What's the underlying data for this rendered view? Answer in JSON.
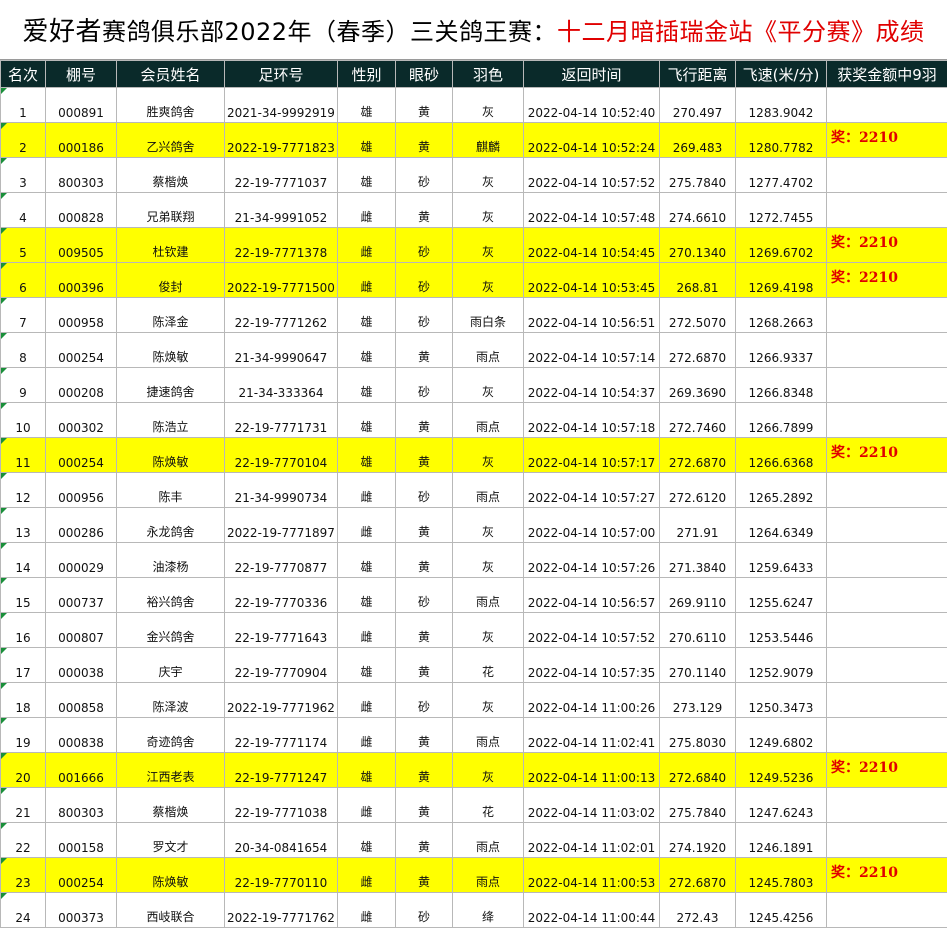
{
  "title": {
    "part1": "爱好者",
    "part2": "赛鸽俱乐部2022年（春季）三关鸽王赛：",
    "part3": "十二月暗插瑞金站《平分赛》成绩"
  },
  "headers": [
    "名次",
    "棚号",
    "会员姓名",
    "足环号",
    "性别",
    "眼砂",
    "羽色",
    "返回时间",
    "飞行距离",
    "飞速(米/分)",
    "获奖金额中9羽"
  ],
  "colors": {
    "highlight": "#ffff00",
    "prize": "#e00000",
    "header_bg": "#0a2a2a"
  },
  "rows": [
    {
      "rank": "1",
      "shed": "000891",
      "name": "胜爽鸽舍",
      "ring": "2021-34-9992919",
      "sex": "雄",
      "eye": "黄",
      "color": "灰",
      "time": "2022-04-14 10:52:40",
      "dist": "270.497",
      "speed": "1283.9042",
      "prize": "",
      "hl": false
    },
    {
      "rank": "2",
      "shed": "000186",
      "name": "乙兴鸽舍",
      "ring": "2022-19-7771823",
      "sex": "雄",
      "eye": "黄",
      "color": "麒麟",
      "time": "2022-04-14 10:52:24",
      "dist": "269.483",
      "speed": "1280.7782",
      "prize": "奖：2210",
      "hl": true
    },
    {
      "rank": "3",
      "shed": "800303",
      "name": "蔡楷焕",
      "ring": "22-19-7771037",
      "sex": "雄",
      "eye": "砂",
      "color": "灰",
      "time": "2022-04-14 10:57:52",
      "dist": "275.7840",
      "speed": "1277.4702",
      "prize": "",
      "hl": false
    },
    {
      "rank": "4",
      "shed": "000828",
      "name": "兄弟联翔",
      "ring": "21-34-9991052",
      "sex": "雌",
      "eye": "黄",
      "color": "灰",
      "time": "2022-04-14 10:57:48",
      "dist": "274.6610",
      "speed": "1272.7455",
      "prize": "",
      "hl": false
    },
    {
      "rank": "5",
      "shed": "009505",
      "name": "杜钦建",
      "ring": "22-19-7771378",
      "sex": "雌",
      "eye": "砂",
      "color": "灰",
      "time": "2022-04-14 10:54:45",
      "dist": "270.1340",
      "speed": "1269.6702",
      "prize": "奖：2210",
      "hl": true
    },
    {
      "rank": "6",
      "shed": "000396",
      "name": "俊封",
      "ring": "2022-19-7771500",
      "sex": "雌",
      "eye": "砂",
      "color": "灰",
      "time": "2022-04-14 10:53:45",
      "dist": "268.81",
      "speed": "1269.4198",
      "prize": "奖：2210",
      "hl": true
    },
    {
      "rank": "7",
      "shed": "000958",
      "name": "陈泽金",
      "ring": "22-19-7771262",
      "sex": "雄",
      "eye": "砂",
      "color": "雨白条",
      "time": "2022-04-14 10:56:51",
      "dist": "272.5070",
      "speed": "1268.2663",
      "prize": "",
      "hl": false
    },
    {
      "rank": "8",
      "shed": "000254",
      "name": "陈焕敏",
      "ring": "21-34-9990647",
      "sex": "雄",
      "eye": "黄",
      "color": "雨点",
      "time": "2022-04-14 10:57:14",
      "dist": "272.6870",
      "speed": "1266.9337",
      "prize": "",
      "hl": false
    },
    {
      "rank": "9",
      "shed": "000208",
      "name": "捷速鸽舍",
      "ring": "21-34-333364",
      "sex": "雄",
      "eye": "砂",
      "color": "灰",
      "time": "2022-04-14 10:54:37",
      "dist": "269.3690",
      "speed": "1266.8348",
      "prize": "",
      "hl": false
    },
    {
      "rank": "10",
      "shed": "000302",
      "name": "陈浩立",
      "ring": "22-19-7771731",
      "sex": "雄",
      "eye": "黄",
      "color": "雨点",
      "time": "2022-04-14 10:57:18",
      "dist": "272.7460",
      "speed": "1266.7899",
      "prize": "",
      "hl": false
    },
    {
      "rank": "11",
      "shed": "000254",
      "name": "陈焕敏",
      "ring": "22-19-7770104",
      "sex": "雄",
      "eye": "黄",
      "color": "灰",
      "time": "2022-04-14 10:57:17",
      "dist": "272.6870",
      "speed": "1266.6368",
      "prize": "奖：2210",
      "hl": true
    },
    {
      "rank": "12",
      "shed": "000956",
      "name": "陈丰",
      "ring": "21-34-9990734",
      "sex": "雌",
      "eye": "砂",
      "color": "雨点",
      "time": "2022-04-14 10:57:27",
      "dist": "272.6120",
      "speed": "1265.2892",
      "prize": "",
      "hl": false
    },
    {
      "rank": "13",
      "shed": "000286",
      "name": "永龙鸽舍",
      "ring": "2022-19-7771897",
      "sex": "雌",
      "eye": "黄",
      "color": "灰",
      "time": "2022-04-14 10:57:00",
      "dist": "271.91",
      "speed": "1264.6349",
      "prize": "",
      "hl": false
    },
    {
      "rank": "14",
      "shed": "000029",
      "name": "油漆杨",
      "ring": "22-19-7770877",
      "sex": "雄",
      "eye": "黄",
      "color": "灰",
      "time": "2022-04-14 10:57:26",
      "dist": "271.3840",
      "speed": "1259.6433",
      "prize": "",
      "hl": false
    },
    {
      "rank": "15",
      "shed": "000737",
      "name": "裕兴鸽舍",
      "ring": "22-19-7770336",
      "sex": "雄",
      "eye": "砂",
      "color": "雨点",
      "time": "2022-04-14 10:56:57",
      "dist": "269.9110",
      "speed": "1255.6247",
      "prize": "",
      "hl": false
    },
    {
      "rank": "16",
      "shed": "000807",
      "name": "金兴鸽舍",
      "ring": "22-19-7771643",
      "sex": "雌",
      "eye": "黄",
      "color": "灰",
      "time": "2022-04-14 10:57:52",
      "dist": "270.6110",
      "speed": "1253.5446",
      "prize": "",
      "hl": false
    },
    {
      "rank": "17",
      "shed": "000038",
      "name": "庆宇",
      "ring": "22-19-7770904",
      "sex": "雄",
      "eye": "黄",
      "color": "花",
      "time": "2022-04-14 10:57:35",
      "dist": "270.1140",
      "speed": "1252.9079",
      "prize": "",
      "hl": false
    },
    {
      "rank": "18",
      "shed": "000858",
      "name": "陈泽波",
      "ring": "2022-19-7771962",
      "sex": "雌",
      "eye": "砂",
      "color": "灰",
      "time": "2022-04-14 11:00:26",
      "dist": "273.129",
      "speed": "1250.3473",
      "prize": "",
      "hl": false
    },
    {
      "rank": "19",
      "shed": "000838",
      "name": "奇迹鸽舍",
      "ring": "22-19-7771174",
      "sex": "雌",
      "eye": "黄",
      "color": "雨点",
      "time": "2022-04-14 11:02:41",
      "dist": "275.8030",
      "speed": "1249.6802",
      "prize": "",
      "hl": false
    },
    {
      "rank": "20",
      "shed": "001666",
      "name": "江西老表",
      "ring": "22-19-7771247",
      "sex": "雄",
      "eye": "黄",
      "color": "灰",
      "time": "2022-04-14 11:00:13",
      "dist": "272.6840",
      "speed": "1249.5236",
      "prize": "奖：2210",
      "hl": true
    },
    {
      "rank": "21",
      "shed": "800303",
      "name": "蔡楷焕",
      "ring": "22-19-7771038",
      "sex": "雌",
      "eye": "黄",
      "color": "花",
      "time": "2022-04-14 11:03:02",
      "dist": "275.7840",
      "speed": "1247.6243",
      "prize": "",
      "hl": false
    },
    {
      "rank": "22",
      "shed": "000158",
      "name": "罗文才",
      "ring": "20-34-0841654",
      "sex": "雄",
      "eye": "黄",
      "color": "雨点",
      "time": "2022-04-14 11:02:01",
      "dist": "274.1920",
      "speed": "1246.1891",
      "prize": "",
      "hl": false
    },
    {
      "rank": "23",
      "shed": "000254",
      "name": "陈焕敏",
      "ring": "22-19-7770110",
      "sex": "雌",
      "eye": "黄",
      "color": "雨点",
      "time": "2022-04-14 11:00:53",
      "dist": "272.6870",
      "speed": "1245.7803",
      "prize": "奖：2210",
      "hl": true
    },
    {
      "rank": "24",
      "shed": "000373",
      "name": "西岐联合",
      "ring": "2022-19-7771762",
      "sex": "雌",
      "eye": "砂",
      "color": "绛",
      "time": "2022-04-14 11:00:44",
      "dist": "272.43",
      "speed": "1245.4256",
      "prize": "",
      "hl": false
    }
  ]
}
